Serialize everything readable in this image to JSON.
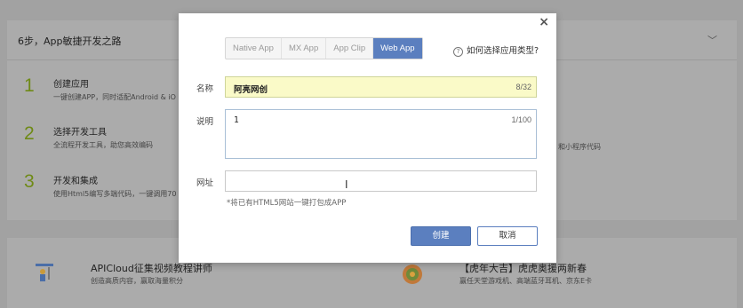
{
  "background": {
    "card_title": "6步，App敏捷开发之路",
    "steps": [
      {
        "num": "1",
        "title": "创建应用",
        "desc": "一键创建APP，同时适配Android & iO"
      },
      {
        "num": "2",
        "title": "选择开发工具",
        "desc": "全流程开发工具，助您高效编码"
      },
      {
        "num": "3",
        "title": "开发和集成",
        "desc": "使用Html5编写多端代码，一键调用70"
      }
    ],
    "right_text": "和小程序代码",
    "promos": [
      {
        "title": "APICloud征集视频教程讲师",
        "desc": "创造高质内容，赢取海量积分"
      },
      {
        "title": "【虎年大吉】虎虎奥援两新春",
        "desc": "赢任天堂游戏机、高端蓝牙耳机、京东E卡"
      }
    ]
  },
  "modal": {
    "close_label": "×",
    "tabs": [
      "Native App",
      "MX App",
      "App Clip",
      "Web App"
    ],
    "active_tab": "Web App",
    "help_text": "如何选择应用类型?",
    "help_icon_glyph": "?",
    "name_label": "名称",
    "name_value": "阿亮网创",
    "name_counter": "8/32",
    "desc_label": "说明",
    "desc_value": "1",
    "desc_counter": "1/100",
    "url_label": "网址",
    "url_value": "",
    "url_hint": "*将已有HTML5网站一键打包成APP",
    "create_button": "创建",
    "cancel_button": "取消"
  },
  "colors": {
    "accent": "#5b7fbf",
    "step_number": "#6f8a16",
    "name_input_bg": "#fafac8"
  }
}
